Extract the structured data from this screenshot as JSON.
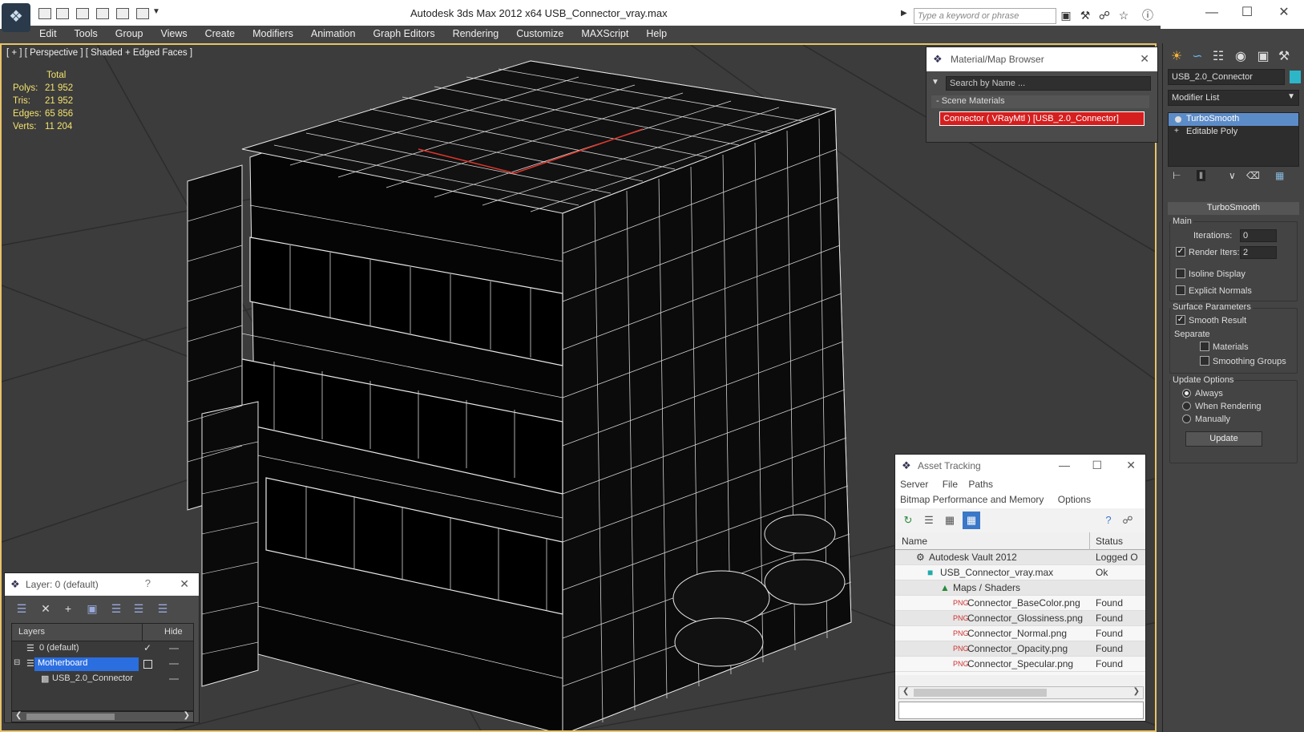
{
  "window": {
    "title": "Autodesk 3ds Max  2012 x64      USB_Connector_vray.max",
    "search_placeholder": "Type a keyword or phrase"
  },
  "menu": [
    "Edit",
    "Tools",
    "Group",
    "Views",
    "Create",
    "Modifiers",
    "Animation",
    "Graph Editors",
    "Rendering",
    "Customize",
    "MAXScript",
    "Help"
  ],
  "viewport": {
    "label": "[ + ] [ Perspective ] [ Shaded + Edged Faces ]",
    "stats": {
      "header": "Total",
      "rows": [
        {
          "k": "Polys:",
          "v": "21 952"
        },
        {
          "k": "Tris:",
          "v": "21 952"
        },
        {
          "k": "Edges:",
          "v": "65 856"
        },
        {
          "k": "Verts:",
          "v": "11 204"
        }
      ]
    }
  },
  "material_browser": {
    "title": "Material/Map Browser",
    "search_placeholder": "Search by Name ...",
    "section": "- Scene Materials",
    "item": "Connector  ( VRayMtl )  [USB_2.0_Connector]"
  },
  "command_panel": {
    "object_name": "USB_2.0_Connector",
    "modifier_list": "Modifier List",
    "stack": [
      "TurboSmooth",
      "Editable Poly"
    ],
    "rollout": "TurboSmooth",
    "main": {
      "label": "Main",
      "iterations_label": "Iterations:",
      "iterations": "0",
      "render_iters_label": "Render Iters:",
      "render_iters": "2",
      "isoline": "Isoline Display",
      "explicit": "Explicit Normals"
    },
    "surface": {
      "label": "Surface Parameters",
      "smooth": "Smooth Result",
      "separate": "Separate",
      "materials": "Materials",
      "smoothing_groups": "Smoothing Groups"
    },
    "update": {
      "label": "Update Options",
      "always": "Always",
      "when_rendering": "When Rendering",
      "manually": "Manually",
      "button": "Update"
    }
  },
  "asset_tracking": {
    "title": "Asset Tracking",
    "menu1": [
      "Server",
      "File",
      "Paths"
    ],
    "menu2": [
      "Bitmap Performance and Memory",
      "Options"
    ],
    "col_name": "Name",
    "col_status": "Status",
    "rows": [
      {
        "name": "Autodesk Vault 2012",
        "status": "Logged O",
        "indent": 0
      },
      {
        "name": "USB_Connector_vray.max",
        "status": "Ok",
        "indent": 1
      },
      {
        "name": "Maps / Shaders",
        "status": "",
        "indent": 2
      },
      {
        "name": "Connector_BaseColor.png",
        "status": "Found",
        "indent": 3
      },
      {
        "name": "Connector_Glossiness.png",
        "status": "Found",
        "indent": 3
      },
      {
        "name": "Connector_Normal.png",
        "status": "Found",
        "indent": 3
      },
      {
        "name": "Connector_Opacity.png",
        "status": "Found",
        "indent": 3
      },
      {
        "name": "Connector_Specular.png",
        "status": "Found",
        "indent": 3
      }
    ]
  },
  "layers": {
    "title": "Layer: 0 (default)",
    "help": "?",
    "col_layers": "Layers",
    "col_hide": "Hide",
    "rows": [
      {
        "name": "0 (default)"
      },
      {
        "name": "Motherboard"
      },
      {
        "name": "USB_2.0_Connector"
      }
    ]
  }
}
